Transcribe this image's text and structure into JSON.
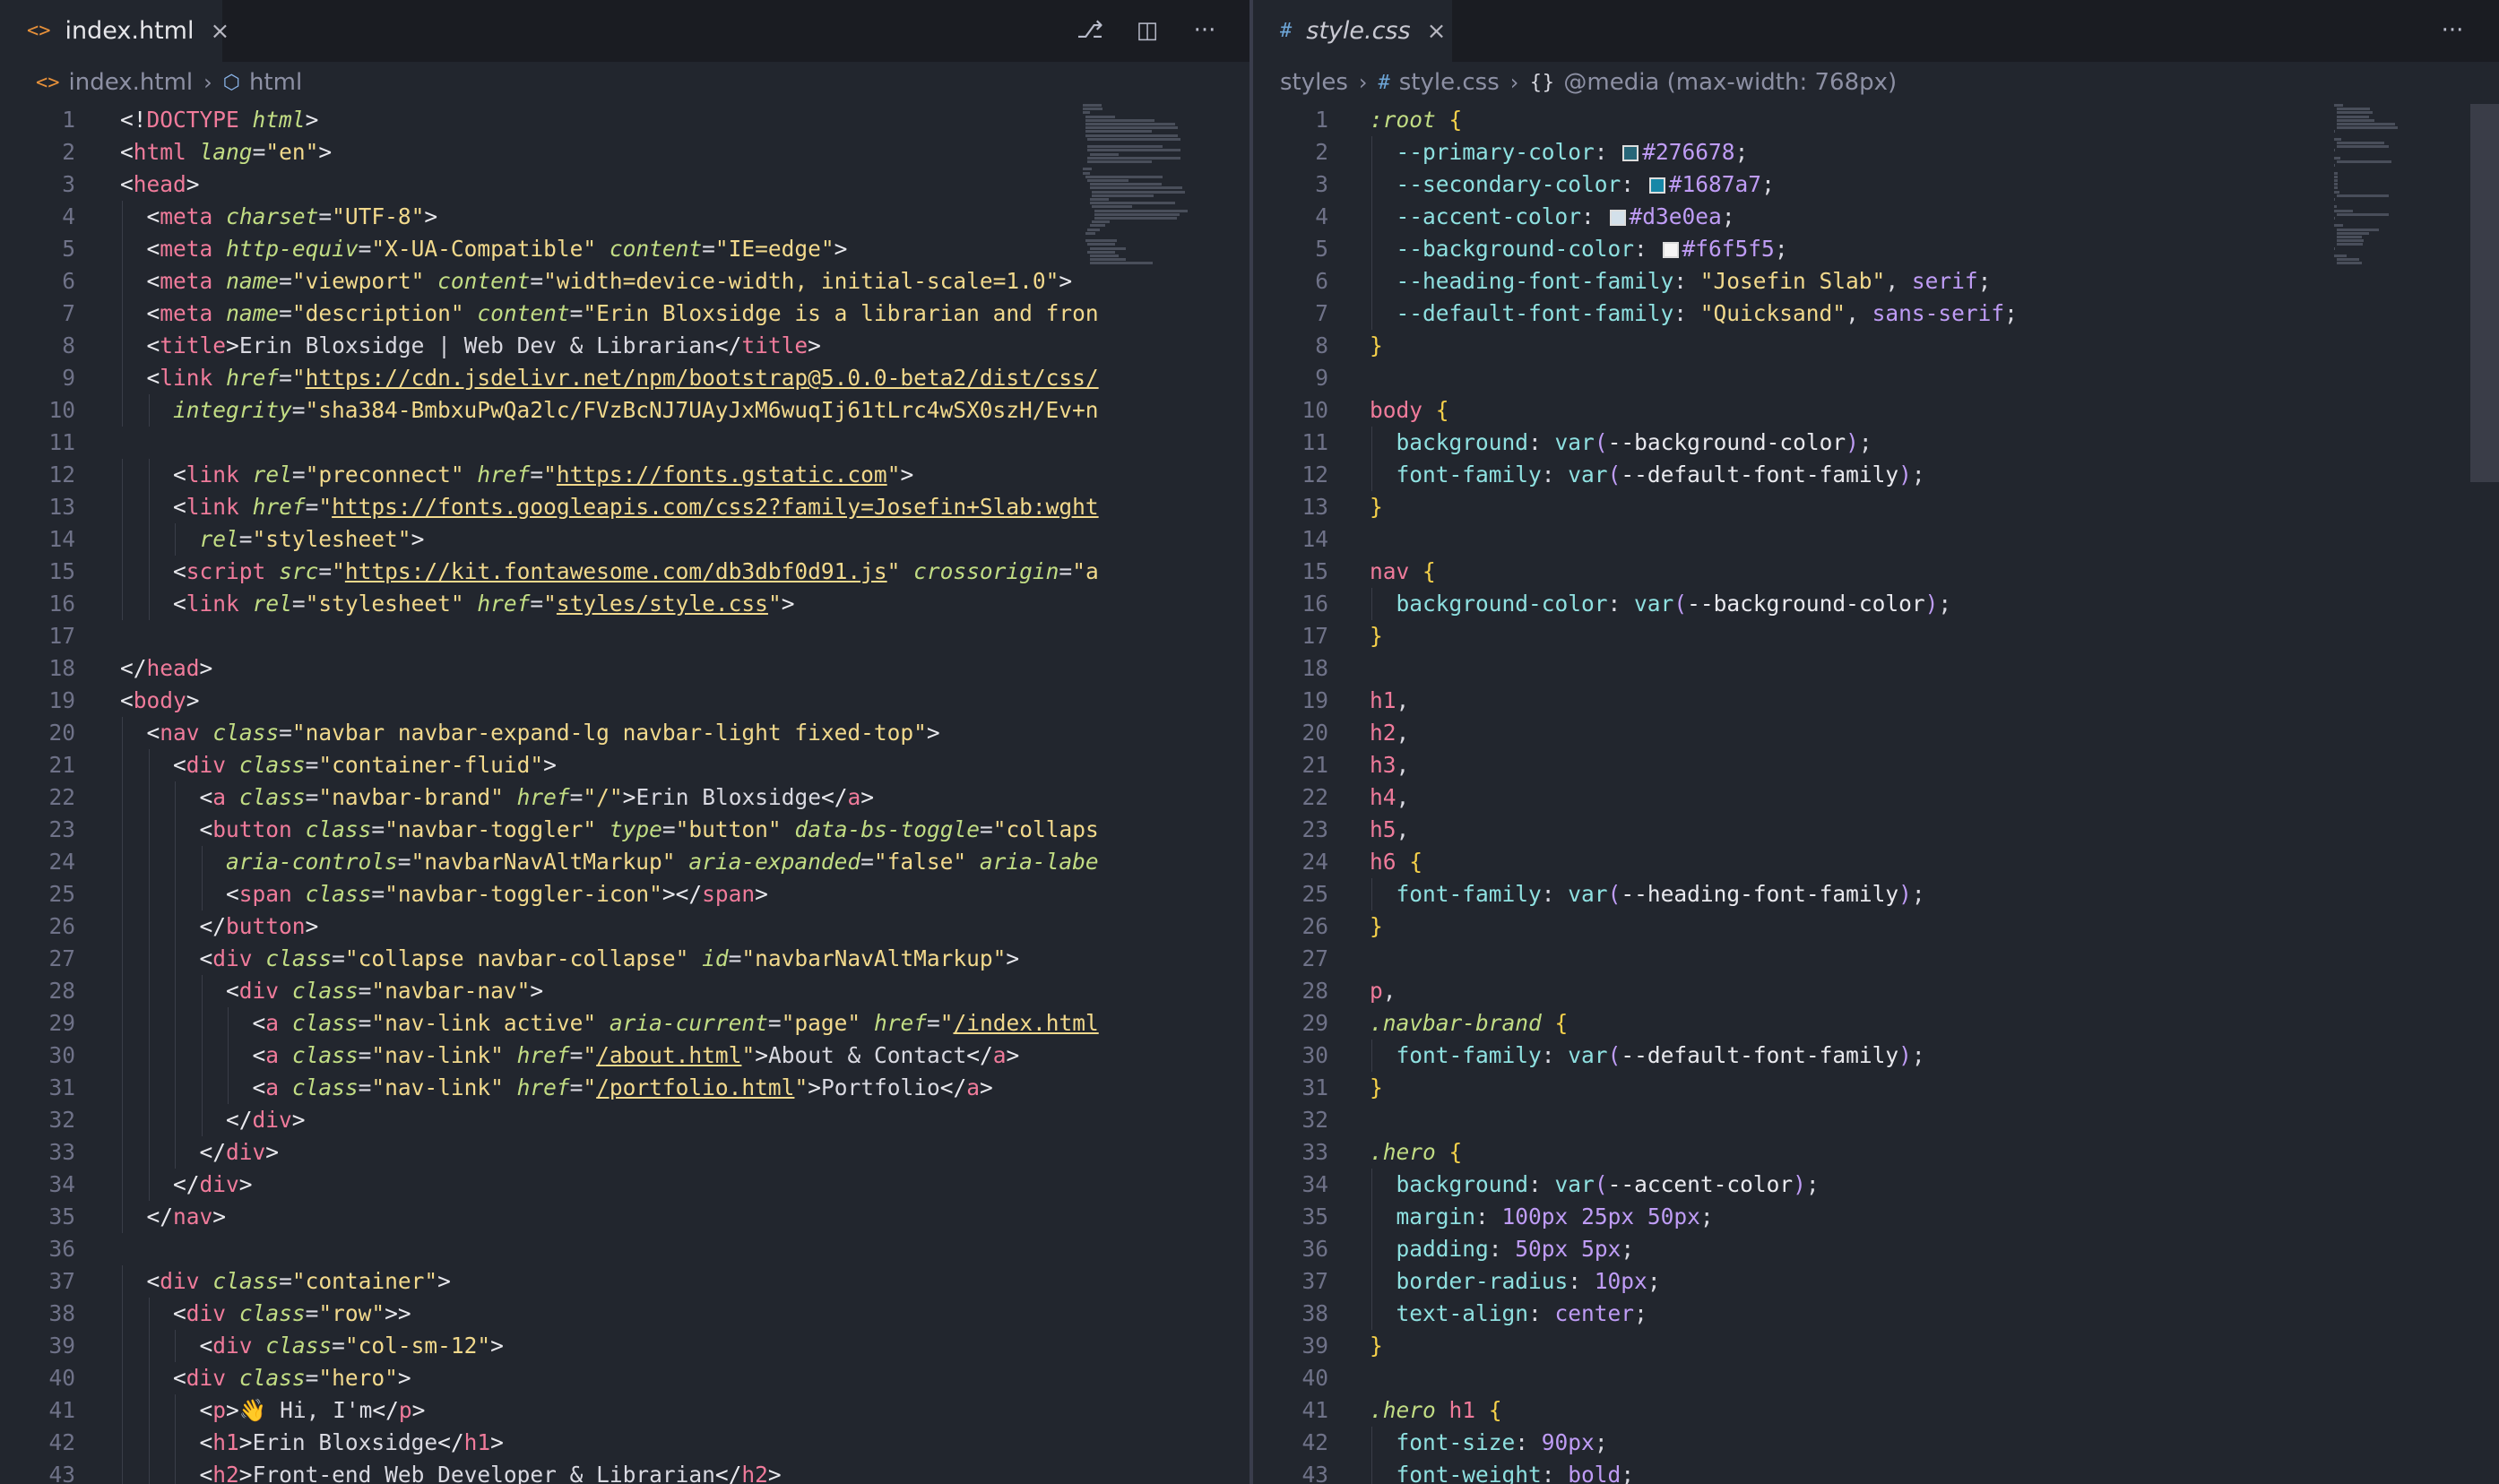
{
  "left": {
    "tab": {
      "icon": "<>",
      "name": "index.html",
      "close": "×"
    },
    "toolbar": {
      "compare": "⎇",
      "split": "◫",
      "more": "···"
    },
    "breadcrumb": {
      "file": "index.html",
      "symbol": "html"
    },
    "lines": [
      {
        "n": "1",
        "html": "<span class='x'>&lt;!</span><span class='t'>DOCTYPE</span> <span class='a'>html</span><span class='x'>&gt;</span>",
        "i": 0
      },
      {
        "n": "2",
        "html": "<span class='x'>&lt;</span><span class='t'>html</span> <span class='a'>lang</span>=<span class='s'>\"en\"</span><span class='x'>&gt;</span>",
        "i": 0
      },
      {
        "n": "3",
        "html": "<span class='x'>&lt;</span><span class='t'>head</span><span class='x'>&gt;</span>",
        "i": 0
      },
      {
        "n": "4",
        "html": "  <span class='x'>&lt;</span><span class='t'>meta</span> <span class='a'>charset</span>=<span class='s'>\"UTF-8\"</span><span class='x'>&gt;</span>",
        "i": 1
      },
      {
        "n": "5",
        "html": "  <span class='x'>&lt;</span><span class='t'>meta</span> <span class='a'>http-equiv</span>=<span class='s'>\"X-UA-Compatible\"</span> <span class='a'>content</span>=<span class='s'>\"IE=edge\"</span><span class='x'>&gt;</span>",
        "i": 1
      },
      {
        "n": "6",
        "html": "  <span class='x'>&lt;</span><span class='t'>meta</span> <span class='a'>name</span>=<span class='s'>\"viewport\"</span> <span class='a'>content</span>=<span class='s'>\"width=device-width, initial-scale=1.0\"</span><span class='x'>&gt;</span>",
        "i": 1
      },
      {
        "n": "7",
        "html": "  <span class='x'>&lt;</span><span class='t'>meta</span> <span class='a'>name</span>=<span class='s'>\"description\"</span> <span class='a'>content</span>=<span class='s'>\"Erin Bloxsidge is a librarian and fron</span>",
        "i": 1
      },
      {
        "n": "8",
        "html": "  <span class='x'>&lt;</span><span class='t'>title</span><span class='x'>&gt;</span>Erin Bloxsidge | Web Dev &amp; Librarian<span class='x'>&lt;/</span><span class='t'>title</span><span class='x'>&gt;</span>",
        "i": 1
      },
      {
        "n": "9",
        "html": "  <span class='x'>&lt;</span><span class='t'>link</span> <span class='a'>href</span>=<span class='s'>\"</span><span class='u'>https://cdn.jsdelivr.net/npm/bootstrap@5.0.0-beta2/dist/css/</span>",
        "i": 1
      },
      {
        "n": "10",
        "html": "    <span class='a'>integrity</span>=<span class='s'>\"sha384-BmbxuPwQa2lc/FVzBcNJ7UAyJxM6wuqIj61tLrc4wSX0szH/Ev+n</span>",
        "i": 2
      },
      {
        "n": "11",
        "html": "",
        "i": 0
      },
      {
        "n": "12",
        "html": "    <span class='x'>&lt;</span><span class='t'>link</span> <span class='a'>rel</span>=<span class='s'>\"preconnect\"</span> <span class='a'>href</span>=<span class='s'>\"</span><span class='u'>https://fonts.gstatic.com</span><span class='s'>\"</span><span class='x'>&gt;</span>",
        "i": 2
      },
      {
        "n": "13",
        "html": "    <span class='x'>&lt;</span><span class='t'>link</span> <span class='a'>href</span>=<span class='s'>\"</span><span class='u'>https://fonts.googleapis.com/css2?family=Josefin+Slab:wght</span>",
        "i": 2
      },
      {
        "n": "14",
        "html": "      <span class='a'>rel</span>=<span class='s'>\"stylesheet\"</span><span class='x'>&gt;</span>",
        "i": 3
      },
      {
        "n": "15",
        "html": "    <span class='x'>&lt;</span><span class='t'>script</span> <span class='a'>src</span>=<span class='s'>\"</span><span class='u'>https://kit.fontawesome.com/db3dbf0d91.js</span><span class='s'>\"</span> <span class='a'>crossorigin</span>=<span class='s'>\"a</span>",
        "i": 2
      },
      {
        "n": "16",
        "html": "    <span class='x'>&lt;</span><span class='t'>link</span> <span class='a'>rel</span>=<span class='s'>\"stylesheet\"</span> <span class='a'>href</span>=<span class='s'>\"</span><span class='u'>styles/style.css</span><span class='s'>\"</span><span class='x'>&gt;</span>",
        "i": 2
      },
      {
        "n": "17",
        "html": "",
        "i": 0
      },
      {
        "n": "18",
        "html": "<span class='x'>&lt;/</span><span class='t'>head</span><span class='x'>&gt;</span>",
        "i": 0
      },
      {
        "n": "19",
        "html": "<span class='x'>&lt;</span><span class='t'>body</span><span class='x'>&gt;</span>",
        "i": 0
      },
      {
        "n": "20",
        "html": "  <span class='x'>&lt;</span><span class='t'>nav</span> <span class='a'>class</span>=<span class='s'>\"navbar navbar-expand-lg navbar-light fixed-top\"</span><span class='x'>&gt;</span>",
        "i": 1
      },
      {
        "n": "21",
        "html": "    <span class='x'>&lt;</span><span class='t'>div</span> <span class='a'>class</span>=<span class='s'>\"container-fluid\"</span><span class='x'>&gt;</span>",
        "i": 2
      },
      {
        "n": "22",
        "html": "      <span class='x'>&lt;</span><span class='t'>a</span> <span class='a'>class</span>=<span class='s'>\"navbar-brand\"</span> <span class='a'>href</span>=<span class='s'>\"/\"</span><span class='x'>&gt;</span>Erin Bloxsidge<span class='x'>&lt;/</span><span class='t'>a</span><span class='x'>&gt;</span>",
        "i": 3
      },
      {
        "n": "23",
        "html": "      <span class='x'>&lt;</span><span class='t'>button</span> <span class='a'>class</span>=<span class='s'>\"navbar-toggler\"</span> <span class='a'>type</span>=<span class='s'>\"button\"</span> <span class='a'>data-bs-toggle</span>=<span class='s'>\"collaps</span>",
        "i": 3
      },
      {
        "n": "24",
        "html": "        <span class='a'>aria-controls</span>=<span class='s'>\"navbarNavAltMarkup\"</span> <span class='a'>aria-expanded</span>=<span class='s'>\"false\"</span> <span class='a'>aria-labe</span>",
        "i": 4
      },
      {
        "n": "25",
        "html": "        <span class='x'>&lt;</span><span class='t'>span</span> <span class='a'>class</span>=<span class='s'>\"navbar-toggler-icon\"</span><span class='x'>&gt;&lt;/</span><span class='t'>span</span><span class='x'>&gt;</span>",
        "i": 4
      },
      {
        "n": "26",
        "html": "      <span class='x'>&lt;/</span><span class='t'>button</span><span class='x'>&gt;</span>",
        "i": 3
      },
      {
        "n": "27",
        "html": "      <span class='x'>&lt;</span><span class='t'>div</span> <span class='a'>class</span>=<span class='s'>\"collapse navbar-collapse\"</span> <span class='a'>id</span>=<span class='s'>\"navbarNavAltMarkup\"</span><span class='x'>&gt;</span>",
        "i": 3
      },
      {
        "n": "28",
        "html": "        <span class='x'>&lt;</span><span class='t'>div</span> <span class='a'>class</span>=<span class='s'>\"navbar-nav\"</span><span class='x'>&gt;</span>",
        "i": 4
      },
      {
        "n": "29",
        "html": "          <span class='x'>&lt;</span><span class='t'>a</span> <span class='a'>class</span>=<span class='s'>\"nav-link active\"</span> <span class='a'>aria-current</span>=<span class='s'>\"page\"</span> <span class='a'>href</span>=<span class='s'>\"</span><span class='u'>/index.html</span>",
        "i": 5
      },
      {
        "n": "30",
        "html": "          <span class='x'>&lt;</span><span class='t'>a</span> <span class='a'>class</span>=<span class='s'>\"nav-link\"</span> <span class='a'>href</span>=<span class='s'>\"</span><span class='u'>/about.html</span><span class='s'>\"</span><span class='x'>&gt;</span>About &amp; Contact<span class='x'>&lt;/</span><span class='t'>a</span><span class='x'>&gt;</span>",
        "i": 5
      },
      {
        "n": "31",
        "html": "          <span class='x'>&lt;</span><span class='t'>a</span> <span class='a'>class</span>=<span class='s'>\"nav-link\"</span> <span class='a'>href</span>=<span class='s'>\"</span><span class='u'>/portfolio.html</span><span class='s'>\"</span><span class='x'>&gt;</span>Portfolio<span class='x'>&lt;/</span><span class='t'>a</span><span class='x'>&gt;</span>",
        "i": 5
      },
      {
        "n": "32",
        "html": "        <span class='x'>&lt;/</span><span class='t'>div</span><span class='x'>&gt;</span>",
        "i": 4
      },
      {
        "n": "33",
        "html": "      <span class='x'>&lt;/</span><span class='t'>div</span><span class='x'>&gt;</span>",
        "i": 3
      },
      {
        "n": "34",
        "html": "    <span class='x'>&lt;/</span><span class='t'>div</span><span class='x'>&gt;</span>",
        "i": 2
      },
      {
        "n": "35",
        "html": "  <span class='x'>&lt;/</span><span class='t'>nav</span><span class='x'>&gt;</span>",
        "i": 1
      },
      {
        "n": "36",
        "html": "",
        "i": 0
      },
      {
        "n": "37",
        "html": "  <span class='x'>&lt;</span><span class='t'>div</span> <span class='a'>class</span>=<span class='s'>\"container\"</span><span class='x'>&gt;</span>",
        "i": 1
      },
      {
        "n": "38",
        "html": "    <span class='x'>&lt;</span><span class='t'>div</span> <span class='a'>class</span>=<span class='s'>\"row\"</span><span class='x'>&gt;&gt;</span>",
        "i": 2
      },
      {
        "n": "39",
        "html": "      <span class='x'>&lt;</span><span class='t'>div</span> <span class='a'>class</span>=<span class='s'>\"col-sm-12\"</span><span class='x'>&gt;</span>",
        "i": 3
      },
      {
        "n": "40",
        "html": "    <span class='x'>&lt;</span><span class='t'>div</span> <span class='a'>class</span>=<span class='s'>\"hero\"</span><span class='x'>&gt;</span>",
        "i": 2
      },
      {
        "n": "41",
        "html": "      <span class='x'>&lt;</span><span class='t'>p</span><span class='x'>&gt;</span>👋 Hi, I'm<span class='x'>&lt;/</span><span class='t'>p</span><span class='x'>&gt;</span>",
        "i": 3
      },
      {
        "n": "42",
        "html": "      <span class='x'>&lt;</span><span class='t'>h1</span><span class='x'>&gt;</span>Erin Bloxsidge<span class='x'>&lt;/</span><span class='t'>h1</span><span class='x'>&gt;</span>",
        "i": 3
      },
      {
        "n": "43",
        "html": "      <span class='x'>&lt;</span><span class='t'>h2</span><span class='x'>&gt;</span>Front-end Web Developer &amp; Librarian<span class='x'>&lt;/</span><span class='t'>h2</span><span class='x'>&gt;</span>",
        "i": 3
      }
    ]
  },
  "right": {
    "tab": {
      "icon": "#",
      "name": "style.css",
      "close": "×"
    },
    "toolbar": {
      "more": "···"
    },
    "breadcrumb": {
      "folder": "styles",
      "file": "style.css",
      "symbol_icon": "{}",
      "symbol": "@media (max-width: 768px)"
    },
    "lines": [
      {
        "n": "1",
        "html": "<span class='cls'>:root</span> <span class='br'>{</span>",
        "i": 0
      },
      {
        "n": "2",
        "html": "  <span class='prop'>--primary-color</span>: <span class='sw' style='background:#276678'></span><span class='num'>#276678</span>;",
        "i": 1
      },
      {
        "n": "3",
        "html": "  <span class='prop'>--secondary-color</span>: <span class='sw' style='background:#1687a7'></span><span class='num'>#1687a7</span>;",
        "i": 1
      },
      {
        "n": "4",
        "html": "  <span class='prop'>--accent-color</span>: <span class='sw' style='background:#d3e0ea'></span><span class='num'>#d3e0ea</span>;",
        "i": 1
      },
      {
        "n": "5",
        "html": "  <span class='prop'>--background-color</span>: <span class='sw' style='background:#f6f5f5'></span><span class='num'>#f6f5f5</span>;",
        "i": 1
      },
      {
        "n": "6",
        "html": "  <span class='prop'>--heading-font-family</span>: <span class='s'>\"Josefin Slab\"</span>, <span class='kw'>serif</span>;",
        "i": 1
      },
      {
        "n": "7",
        "html": "  <span class='prop'>--default-font-family</span>: <span class='s'>\"Quicksand\"</span>, <span class='kw'>sans-serif</span>;",
        "i": 1
      },
      {
        "n": "8",
        "html": "<span class='br'>}</span>",
        "i": 0
      },
      {
        "n": "9",
        "html": "",
        "i": 0
      },
      {
        "n": "10",
        "html": "<span class='sel'>body</span> <span class='br'>{</span>",
        "i": 0
      },
      {
        "n": "11",
        "html": "  <span class='prop'>background</span>: <span class='fn'>var</span><span class='kw'>(</span><span class='var'>--background-color</span><span class='kw'>)</span>;",
        "i": 1
      },
      {
        "n": "12",
        "html": "  <span class='prop'>font-family</span>: <span class='fn'>var</span><span class='kw'>(</span><span class='var'>--default-font-family</span><span class='kw'>)</span>;",
        "i": 1
      },
      {
        "n": "13",
        "html": "<span class='br'>}</span>",
        "i": 0
      },
      {
        "n": "14",
        "html": "",
        "i": 0
      },
      {
        "n": "15",
        "html": "<span class='sel'>nav</span> <span class='br'>{</span>",
        "i": 0
      },
      {
        "n": "16",
        "html": "  <span class='prop'>background-color</span>: <span class='fn'>var</span><span class='kw'>(</span><span class='var'>--background-color</span><span class='kw'>)</span>;",
        "i": 1
      },
      {
        "n": "17",
        "html": "<span class='br'>}</span>",
        "i": 0
      },
      {
        "n": "18",
        "html": "",
        "i": 0
      },
      {
        "n": "19",
        "html": "<span class='sel'>h1</span>,",
        "i": 0
      },
      {
        "n": "20",
        "html": "<span class='sel'>h2</span>,",
        "i": 0
      },
      {
        "n": "21",
        "html": "<span class='sel'>h3</span>,",
        "i": 0
      },
      {
        "n": "22",
        "html": "<span class='sel'>h4</span>,",
        "i": 0
      },
      {
        "n": "23",
        "html": "<span class='sel'>h5</span>,",
        "i": 0
      },
      {
        "n": "24",
        "html": "<span class='sel'>h6</span> <span class='br'>{</span>",
        "i": 0
      },
      {
        "n": "25",
        "html": "  <span class='prop'>font-family</span>: <span class='fn'>var</span><span class='kw'>(</span><span class='var'>--heading-font-family</span><span class='kw'>)</span>;",
        "i": 1
      },
      {
        "n": "26",
        "html": "<span class='br'>}</span>",
        "i": 0
      },
      {
        "n": "27",
        "html": "",
        "i": 0
      },
      {
        "n": "28",
        "html": "<span class='sel'>p</span>,",
        "i": 0
      },
      {
        "n": "29",
        "html": "<span class='cls'>.navbar-brand</span> <span class='br'>{</span>",
        "i": 0
      },
      {
        "n": "30",
        "html": "  <span class='prop'>font-family</span>: <span class='fn'>var</span><span class='kw'>(</span><span class='var'>--default-font-family</span><span class='kw'>)</span>;",
        "i": 1
      },
      {
        "n": "31",
        "html": "<span class='br'>}</span>",
        "i": 0
      },
      {
        "n": "32",
        "html": "",
        "i": 0
      },
      {
        "n": "33",
        "html": "<span class='cls'>.hero</span> <span class='br'>{</span>",
        "i": 0
      },
      {
        "n": "34",
        "html": "  <span class='prop'>background</span>: <span class='fn'>var</span><span class='kw'>(</span><span class='var'>--accent-color</span><span class='kw'>)</span>;",
        "i": 1
      },
      {
        "n": "35",
        "html": "  <span class='prop'>margin</span>: <span class='num'>100px</span> <span class='num'>25px</span> <span class='num'>50px</span>;",
        "i": 1
      },
      {
        "n": "36",
        "html": "  <span class='prop'>padding</span>: <span class='num'>50px</span> <span class='num'>5px</span>;",
        "i": 1
      },
      {
        "n": "37",
        "html": "  <span class='prop'>border-radius</span>: <span class='num'>10px</span>;",
        "i": 1
      },
      {
        "n": "38",
        "html": "  <span class='prop'>text-align</span>: <span class='kw'>center</span>;",
        "i": 1
      },
      {
        "n": "39",
        "html": "<span class='br'>}</span>",
        "i": 0
      },
      {
        "n": "40",
        "html": "",
        "i": 0
      },
      {
        "n": "41",
        "html": "<span class='cls'>.hero</span> <span class='sel'>h1</span> <span class='br'>{</span>",
        "i": 0
      },
      {
        "n": "42",
        "html": "  <span class='prop'>font-size</span>: <span class='num'>90px</span>;",
        "i": 1
      },
      {
        "n": "43",
        "html": "  <span class='prop'>font-weight</span>: <span class='kw'>bold</span>;",
        "i": 1
      }
    ]
  },
  "colors": {
    "editor_bg": "#22262e",
    "tabbar_bg": "#1a1c22",
    "tag": "#f07b9b",
    "attribute": "#c2dd84",
    "string": "#f2d98c",
    "property": "#8ee0e0",
    "number": "#bf9cf5",
    "line_number": "#6f7288"
  }
}
